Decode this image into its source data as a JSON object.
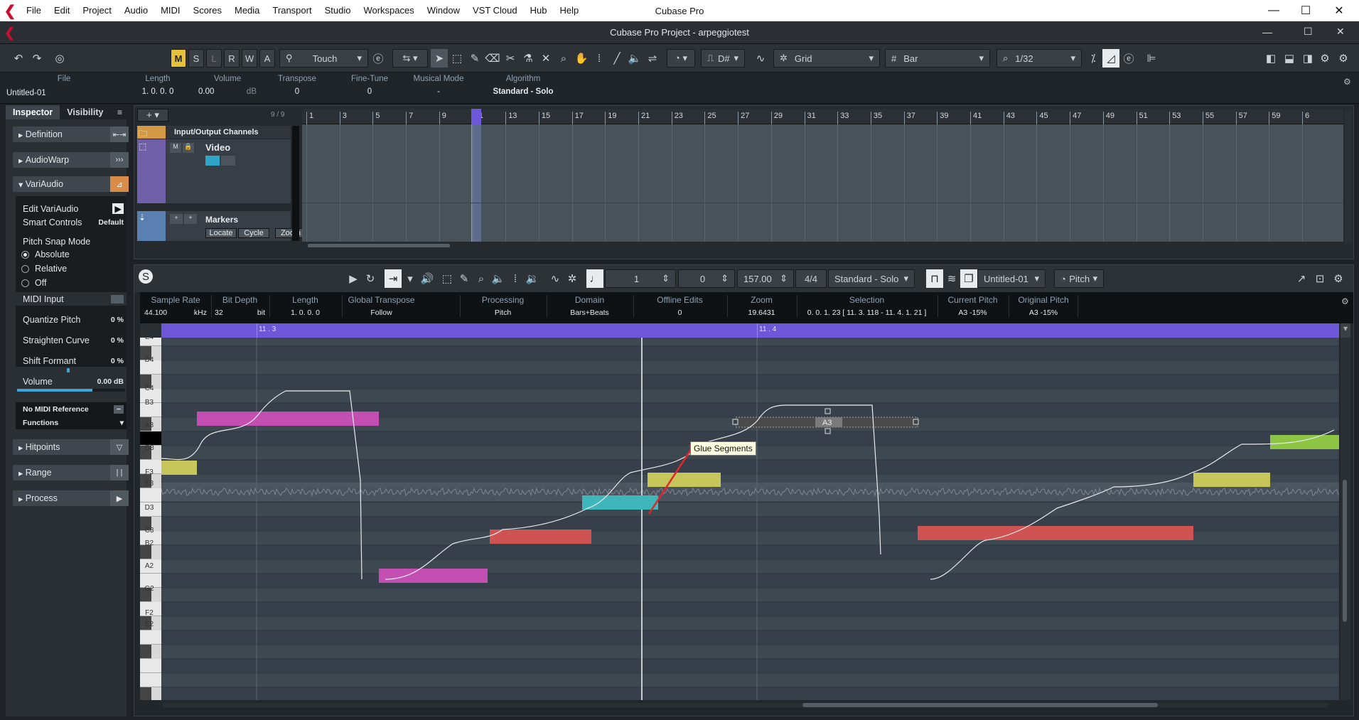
{
  "menubar": {
    "items": [
      "File",
      "Edit",
      "Project",
      "Audio",
      "MIDI",
      "Scores",
      "Media",
      "Transport",
      "Studio",
      "Workspaces",
      "Window",
      "VST Cloud",
      "Hub",
      "Help"
    ],
    "app_title": "Cubase Pro"
  },
  "project_bar": {
    "title": "Cubase Pro Project - arpeggiotest"
  },
  "toolbar": {
    "msrwa": [
      "M",
      "S",
      "L",
      "R",
      "W",
      "A"
    ],
    "automation_mode": "Touch",
    "key": "D#",
    "snap_type": "Grid",
    "grid_type": "Bar",
    "quantize": "1/32"
  },
  "info_line": {
    "file_label": "File",
    "file_value": "Untitled-01",
    "length_label": "Length",
    "length_value": "1. 0. 0.   0",
    "volume_label": "Volume",
    "volume_value": "0.00",
    "volume_unit": "dB",
    "transpose_label": "Transpose",
    "transpose_value": "0",
    "finetune_label": "Fine-Tune",
    "finetune_value": "0",
    "musical_mode_label": "Musical Mode",
    "musical_mode_value": "-",
    "algorithm_label": "Algorithm",
    "algorithm_value": "Standard - Solo"
  },
  "inspector": {
    "tab_inspector": "Inspector",
    "tab_visibility": "Visibility",
    "sections": [
      "Definition",
      "AudioWarp",
      "VariAudio",
      "Hitpoints",
      "Range",
      "Process"
    ],
    "edit_variaudio": "Edit VariAudio",
    "smart_controls": "Smart Controls",
    "smart_controls_value": "Default",
    "pitch_snap_mode": "Pitch Snap Mode",
    "snap_options": [
      "Absolute",
      "Relative",
      "Off"
    ],
    "midi_input": "MIDI Input",
    "quantize_pitch": "Quantize Pitch",
    "quantize_pitch_value": "0 %",
    "straighten_curve": "Straighten Curve",
    "straighten_curve_value": "0 %",
    "shift_formant": "Shift Formant",
    "shift_formant_value": "0 %",
    "volume": "Volume",
    "volume_value": "0.00 dB",
    "no_midi_reference": "No MIDI Reference",
    "functions": "Functions"
  },
  "project_window": {
    "track_count": "9 / 9",
    "tracks": [
      "Input/Output Channels",
      "Video",
      "Markers"
    ],
    "marker_buttons": [
      "Locate",
      "Cycle",
      "Zoom"
    ],
    "ruler_bars": [
      "1",
      "3",
      "5",
      "7",
      "9",
      "11",
      "13",
      "15",
      "17",
      "19",
      "21",
      "23",
      "25",
      "27",
      "29",
      "31",
      "33",
      "35",
      "37",
      "39",
      "41",
      "43",
      "45",
      "47",
      "49",
      "51",
      "53",
      "55",
      "57",
      "59",
      "6"
    ]
  },
  "editor": {
    "position_bars": "1",
    "position_ticks": "0",
    "tempo": "157.00",
    "signature": "4/4",
    "algorithm": "Standard - Solo",
    "event": "Untitled-01",
    "mode": "Pitch",
    "info": {
      "sample_rate_label": "Sample Rate",
      "sample_rate_value": "44.100",
      "sample_rate_unit": "kHz",
      "bit_depth_label": "Bit Depth",
      "bit_depth_value": "32",
      "bit_depth_unit": "bit",
      "length_label": "Length",
      "length_value": "1. 0. 0.   0",
      "global_transpose_label": "Global Transpose",
      "global_transpose_value": "Follow",
      "processing_label": "Processing",
      "processing_value": "Pitch",
      "domain_label": "Domain",
      "domain_value": "Bars+Beats",
      "offline_edits_label": "Offline Edits",
      "offline_edits_value": "0",
      "zoom_label": "Zoom",
      "zoom_value": "19.6431",
      "selection_label": "Selection",
      "selection_value": "0. 0. 1. 23 [ 11. 3. 118 - 11. 4. 1. 21 ]",
      "current_pitch_label": "Current Pitch",
      "current_pitch_value": "A3  -15%",
      "original_pitch_label": "Original Pitch",
      "original_pitch_value": "A3  -15%"
    },
    "ruler_marks": [
      "11 . 3",
      "11 . 4"
    ],
    "key_labels": [
      "E4",
      "D4",
      "C4",
      "B3",
      "A3",
      "G3",
      "F3",
      "E3",
      "D3",
      "C3",
      "B2",
      "A2",
      "G2",
      "F2",
      "E2"
    ],
    "selected_note_label": "A3",
    "tooltip": "Glue Segments"
  },
  "colors": {
    "accent_purple": "#6e57d9",
    "note_magenta": "#c34fb3",
    "note_yellow": "#c6c65a",
    "note_cyan": "#3fb6b9",
    "note_red": "#cf5353",
    "note_green": "#8cc443",
    "msrwa_active": "#e6c23a",
    "arrow_red": "#e0262b"
  }
}
